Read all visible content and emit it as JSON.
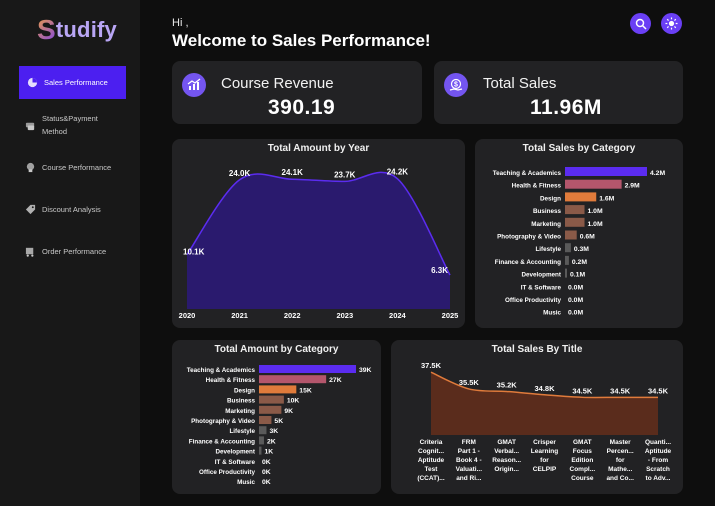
{
  "app": {
    "logo_text": "tudify",
    "logo_letter": "S"
  },
  "sidebar": {
    "items": [
      {
        "label": "Sales Performance",
        "icon": "chart-pie-icon"
      },
      {
        "label": "Status&Payment Method",
        "icon": "payment-icon"
      },
      {
        "label": "Course Performance",
        "icon": "course-icon"
      },
      {
        "label": "Discount Analysis",
        "icon": "discount-icon"
      },
      {
        "label": "Order Performance",
        "icon": "order-icon"
      }
    ]
  },
  "header": {
    "greeting": "Hi ,",
    "title": "Welcome to Sales Performance!"
  },
  "kpis": {
    "revenue": {
      "label": "Course Revenue",
      "value": "390.19"
    },
    "sales": {
      "label": "Total Sales",
      "value": "11.96M"
    }
  },
  "colors": {
    "accent": "#5b2cf0",
    "card": "#222224",
    "area": "#2a1a6e",
    "bar_orange": "#e07b3b",
    "bar_pink": "#b4566c",
    "bar_brown": "#8a5a48"
  },
  "chart_data": [
    {
      "type": "area",
      "title": "Total Amount by Year",
      "x": [
        "2020",
        "2021",
        "2022",
        "2023",
        "2024",
        "2025"
      ],
      "values": [
        10.1,
        24.0,
        24.1,
        23.7,
        24.2,
        6.3
      ],
      "labels": [
        "10.1K",
        "24.0K",
        "24.1K",
        "23.7K",
        "24.2K",
        "6.3K"
      ],
      "ylim": [
        0,
        26
      ]
    },
    {
      "type": "bar",
      "title": "Total Sales by Category",
      "orientation": "horizontal",
      "categories": [
        "Teaching & Academics",
        "Health & Fitness",
        "Design",
        "Business",
        "Marketing",
        "Photography & Video",
        "Lifestyle",
        "Finance & Accounting",
        "Development",
        "IT & Software",
        "Office Productivity",
        "Music"
      ],
      "values": [
        4.2,
        2.9,
        1.6,
        1.0,
        1.0,
        0.6,
        0.3,
        0.2,
        0.1,
        0.0,
        0.0,
        0.0
      ],
      "labels": [
        "4.2M",
        "2.9M",
        "1.6M",
        "1.0M",
        "1.0M",
        "0.6M",
        "0.3M",
        "0.2M",
        "0.1M",
        "0.0M",
        "0.0M",
        "0.0M"
      ]
    },
    {
      "type": "bar",
      "title": "Total Amount by Category",
      "orientation": "horizontal",
      "categories": [
        "Teaching & Academics",
        "Health & Fitness",
        "Design",
        "Business",
        "Marketing",
        "Photography & Video",
        "Lifestyle",
        "Finance & Accounting",
        "Development",
        "IT & Software",
        "Office Productivity",
        "Music"
      ],
      "values": [
        39,
        27,
        15,
        10,
        9,
        5,
        3,
        2,
        1,
        0,
        0,
        0
      ],
      "labels": [
        "39K",
        "27K",
        "15K",
        "10K",
        "9K",
        "5K",
        "3K",
        "2K",
        "1K",
        "0K",
        "0K",
        "0K"
      ]
    },
    {
      "type": "area",
      "title": "Total Sales By Title",
      "categories": [
        [
          "Criteria",
          "Cognit...",
          "Aptitude",
          "Test",
          "(CCAT)..."
        ],
        [
          "FRM",
          "Part 1 -",
          "Book 4 -",
          "Valuati...",
          "and Ri..."
        ],
        [
          "GMAT",
          "Verbal...",
          "Reason...",
          "Origin..."
        ],
        [
          "Crisper",
          "Learning",
          "for",
          "CELPIP"
        ],
        [
          "GMAT",
          "Focus",
          "Edition",
          "Compl...",
          "Course"
        ],
        [
          "Master",
          "Percen...",
          "for",
          "Mathe...",
          "and Co..."
        ],
        [
          "Quanti...",
          "Aptitude",
          "- From",
          "Scratch",
          "to Adv..."
        ]
      ],
      "values": [
        37.5,
        35.5,
        35.2,
        34.8,
        34.5,
        34.5,
        34.5
      ],
      "labels": [
        "37.5K",
        "35.5K",
        "35.2K",
        "34.8K",
        "34.5K",
        "34.5K",
        "34.5K"
      ]
    }
  ]
}
